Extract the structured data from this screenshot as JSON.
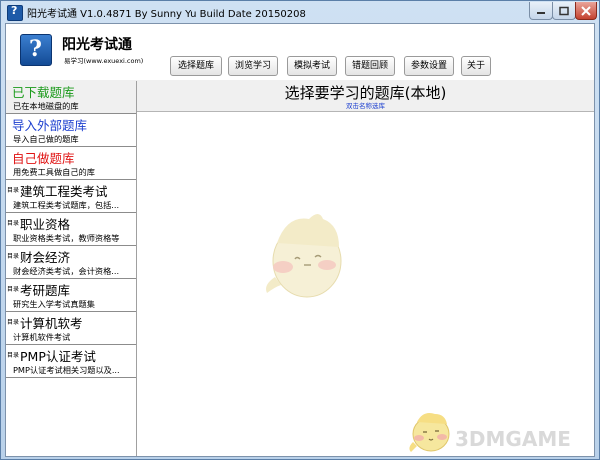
{
  "window": {
    "title": "阳光考试通 V1.0.4871 By Sunny Yu  Build Date 20150208"
  },
  "header": {
    "app_name": "阳光考试通",
    "app_subtitle": "易学习(www.exuexi.com)",
    "logo_icon": "question-mark-book-icon"
  },
  "toolbar": [
    {
      "label": "选择题库"
    },
    {
      "label": "浏览学习"
    },
    {
      "label": "模拟考试"
    },
    {
      "label": "错题回顾"
    },
    {
      "label": "参数设置"
    },
    {
      "label": "关于"
    }
  ],
  "sidebar": {
    "items": [
      {
        "title": "已下载题库",
        "sub": "已在本地磁盘的库",
        "color": "#1a9a1a",
        "selected": true
      },
      {
        "title": "导入外部题库",
        "sub": "导入自己做的题库",
        "color": "#1c3fcf"
      },
      {
        "title": "自己做题库",
        "sub": "用免费工具做自己的库",
        "color": "#e01414"
      },
      {
        "tag": "目录",
        "title": "建筑工程类考试",
        "sub": "建筑工程类考试题库，包括..."
      },
      {
        "tag": "目录",
        "title": "职业资格",
        "sub": "职业资格类考试，教师资格等"
      },
      {
        "tag": "目录",
        "title": "财会经济",
        "sub": "财会经济类考试，会计资格..."
      },
      {
        "tag": "目录",
        "title": "考研题库",
        "sub": "研究生入学考试真题集"
      },
      {
        "tag": "目录",
        "title": "计算机软考",
        "sub": "计算机软件考试"
      },
      {
        "tag": "目录",
        "title": "PMP认证考试",
        "sub": "PMP认证考试相关习题以及..."
      }
    ]
  },
  "main": {
    "title": "选择要学习的题库(本地)",
    "hint": "双击名称选库"
  },
  "watermark": "3DMGAME"
}
